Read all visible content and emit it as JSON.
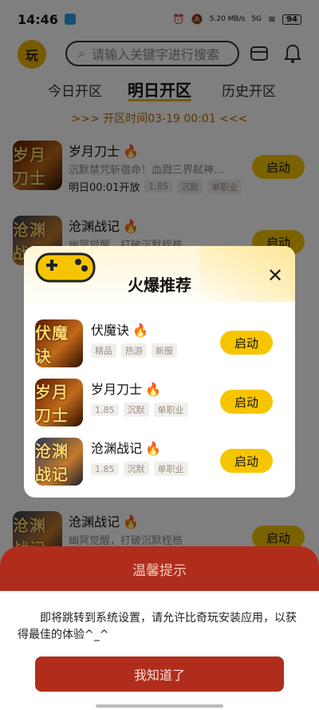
{
  "status_bar": {
    "time": "14:46",
    "net_speed": "5.20 MB/s",
    "signal": "5G",
    "battery": "94"
  },
  "header": {
    "logo_text": "玩",
    "search_placeholder": "请输入关键字进行搜索"
  },
  "tabs": [
    {
      "label": "今日开区"
    },
    {
      "label": "明日开区",
      "active": true
    },
    {
      "label": "历史开区"
    }
  ],
  "open_time": ">>>  开区时间03-19 00:01  <<<",
  "list": [
    {
      "name": "岁月刀士",
      "thumb": "岁月刀士",
      "desc": "沉默禁咒斩宿命！血戮三界弑神…",
      "time": "明日00:01开放",
      "tags": [
        "1.85",
        "沉默",
        "单职业"
      ],
      "button": "启动"
    },
    {
      "name": "沧渊战记",
      "thumb": "沧渊战记",
      "desc": "幽冥觉醒，打破沉默桎梏",
      "button": "启动"
    },
    {
      "name": "沧渊战记",
      "thumb": "沧渊战记",
      "desc": "幽冥觉醒，打破沉默桎梏",
      "button": "启动"
    }
  ],
  "modal": {
    "title": "火爆推荐",
    "items": [
      {
        "name": "伏魔诀",
        "thumb": "伏魔诀",
        "tags": [
          "精品",
          "热游",
          "新服"
        ],
        "button": "启动"
      },
      {
        "name": "岁月刀士",
        "thumb": "岁月刀士",
        "tags": [
          "1.85",
          "沉默",
          "单职业"
        ],
        "button": "启动"
      },
      {
        "name": "沧渊战记",
        "thumb": "沧渊战记",
        "tags": [
          "1.85",
          "沉默",
          "单职业"
        ],
        "button": "启动"
      }
    ]
  },
  "sheet": {
    "title": "温馨提示",
    "message": "即将跳转到系统设置，请允许比奇玩安装应用，以获得最佳的体验^_^",
    "confirm": "我知道了"
  },
  "colors": {
    "accent": "#f7c500",
    "sheet": "#b02d1c"
  }
}
